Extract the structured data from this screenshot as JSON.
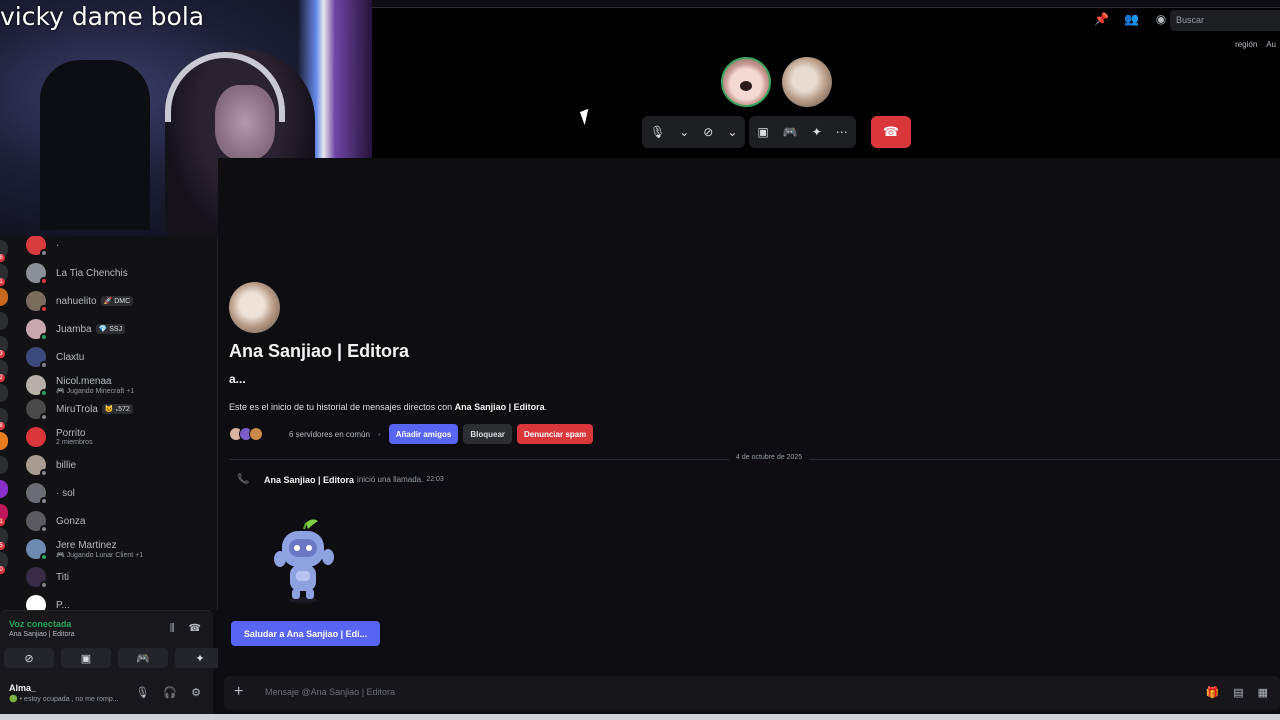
{
  "webcam": {
    "title": "vicky dame bola"
  },
  "topbar": {
    "search_placeholder": "Buscar",
    "region_text": "región",
    "region_text_2": "Au"
  },
  "dm_list": [
    {
      "name": "·",
      "tag": "",
      "sub": "",
      "color": "#d83c3e",
      "status": "#80848e"
    },
    {
      "name": "La Tia Chenchis",
      "tag": "",
      "sub": "",
      "color": "#8a8f98",
      "status": "#da373c"
    },
    {
      "name": "nahuelito",
      "tag": "🚀 DMC",
      "sub": "",
      "color": "#7b6d5c",
      "status": "#da373c"
    },
    {
      "name": "Juamba",
      "tag": "💎 SSJ",
      "sub": "",
      "color": "#c7a8b0",
      "status": "#23a55a"
    },
    {
      "name": "Claxtu",
      "tag": "",
      "sub": "",
      "color": "#3a4a7a",
      "status": "#80848e"
    },
    {
      "name": "Nicol.menaa",
      "tag": "",
      "sub": "🎮 Jugando Minecraft +1",
      "color": "#b8b0a8",
      "status": "#23a55a"
    },
    {
      "name": "MiruTrola",
      "tag": "🐱 ₛ572",
      "sub": "",
      "color": "#4a4a4a",
      "status": "#80848e"
    },
    {
      "name": "Porrito",
      "tag": "",
      "sub": "2 miembros",
      "color": "#da373c",
      "status": ""
    },
    {
      "name": "billie",
      "tag": "",
      "sub": "",
      "color": "#a89c90",
      "status": "#80848e"
    },
    {
      "name": "· sol",
      "tag": "",
      "sub": "",
      "color": "#6c6c74",
      "status": "#80848e"
    },
    {
      "name": "Gonza",
      "tag": "",
      "sub": "",
      "color": "#5a5a60",
      "status": "#80848e"
    },
    {
      "name": "Jere Martinez",
      "tag": "",
      "sub": "🎮 Jugando Lunar Client +1",
      "color": "#6d8bb0",
      "status": "#23a55a"
    },
    {
      "name": "Titi",
      "tag": "",
      "sub": "",
      "color": "#3a2a4a",
      "status": "#80848e"
    },
    {
      "name": "P...",
      "tag": "",
      "sub": "",
      "color": "#ffffff",
      "status": ""
    }
  ],
  "voice": {
    "title": "Voz conectada",
    "subtitle": "Ana Sanjiao | Editora"
  },
  "user": {
    "name": "Alma_",
    "status": "🟢 • estoy ocupada , no me romp..."
  },
  "profile": {
    "name": "Ana Sanjiao | Editora",
    "handle": "a...",
    "intro_prefix": "Este es el inicio de tu historial de mensajes directos con ",
    "intro_name": "Ana Sanjiao | Editora",
    "intro_suffix": ".",
    "mutual_servers": "6 servidores en común",
    "add_friend": "Añadir amigos",
    "block": "Bloquear",
    "report_spam": "Denunciar spam"
  },
  "divider_date": "4 de octubre de 2025",
  "call_message": {
    "author": "Ana Sanjiao | Editora",
    "action": "inició una llamada.",
    "time": "22:03"
  },
  "wave_button": "Saludar a Ana Sanjiao | Edi...",
  "composer": {
    "placeholder": "Mensaje @Ana Sanjiao | Editora"
  },
  "colors": {
    "accent": "#5865f2",
    "danger": "#da373c",
    "online": "#23a55a"
  }
}
